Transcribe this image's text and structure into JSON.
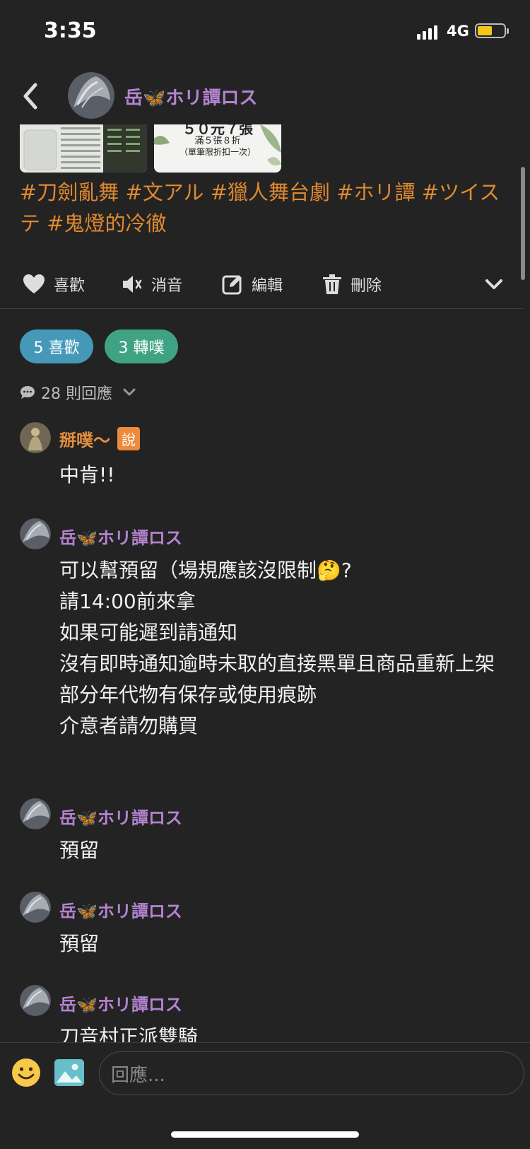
{
  "status": {
    "time": "3:35",
    "network": "4G"
  },
  "header": {
    "author": "岳🦋ホリ譚ロス"
  },
  "post": {
    "tags": "#刀劍亂舞 #文アル #獵人舞台劇 #ホリ譚 #ツイステ #鬼燈的冷徹",
    "image2_lines": [
      "５０元７張",
      "滿５張８折",
      "（單筆限折扣一次）"
    ]
  },
  "actions": {
    "like": "喜歡",
    "mute": "消音",
    "edit": "編輯",
    "delete": "刪除"
  },
  "stats": {
    "likes": "5 喜歡",
    "replurks": "3 轉噗",
    "replies": "28 則回應"
  },
  "comments": [
    {
      "name": "掰噗～",
      "badge": "說",
      "name_color": "#e58f3e",
      "text": "中肯!!"
    },
    {
      "name": "岳🦋ホリ譚ロス",
      "name_color": "#b484d0",
      "text": "可以幫預留（場規應該沒限制🤔?\n請14:00前來拿\n如果可能遲到請通知\n沒有即時通知逾時未取的直接黑單且商品重新上架\n部分年代物有保存或使用痕跡\n介意者請勿購買"
    },
    {
      "name": "岳🦋ホリ譚ロス",
      "name_color": "#b484d0",
      "text": "預留"
    },
    {
      "name": "岳🦋ホリ譚ロス",
      "name_color": "#b484d0",
      "text": "預留"
    },
    {
      "name": "岳🦋ホリ譚ロス",
      "name_color": "#b484d0",
      "text": "刀音村正派雙騎"
    }
  ],
  "composer": {
    "placeholder": "回應..."
  },
  "colors": {
    "accent_orange": "#e0892f",
    "name_purple": "#b484d0",
    "like_blue": "#4598b8",
    "replurk_green": "#3fa383"
  }
}
